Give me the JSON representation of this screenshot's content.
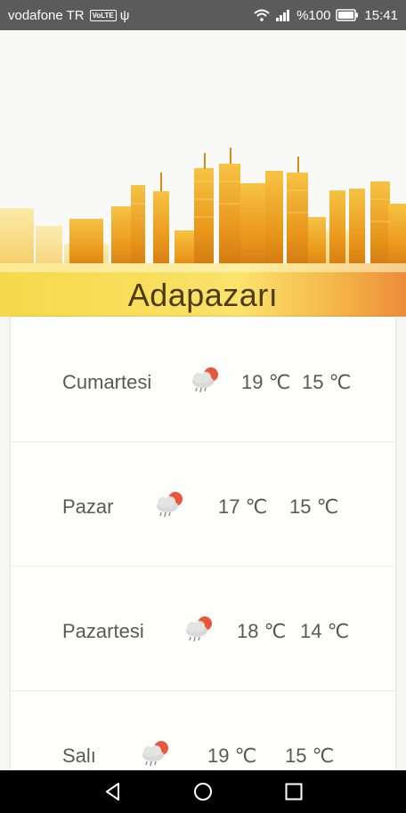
{
  "status_bar": {
    "carrier": "vodafone TR",
    "volte": "VoLTE",
    "usb_symbol": "ψ",
    "battery": "%100",
    "time": "15:41"
  },
  "city": {
    "name": "Adapazarı"
  },
  "forecast": [
    {
      "day": "Cumartesi",
      "icon": "rain-cloud-sun-icon",
      "high": "19 ℃",
      "low": "15 ℃"
    },
    {
      "day": "Pazar",
      "icon": "rain-cloud-sun-icon",
      "high": "17 ℃",
      "low": "15 ℃"
    },
    {
      "day": "Pazartesi",
      "icon": "rain-cloud-sun-icon",
      "high": "18 ℃",
      "low": "14 ℃"
    },
    {
      "day": "Salı",
      "icon": "rain-cloud-sun-icon",
      "high": "19 ℃",
      "low": "15 ℃"
    }
  ],
  "colors": {
    "accent_sun": "#e8573a",
    "banner_gold": "#f2b520",
    "text": "#595959"
  }
}
